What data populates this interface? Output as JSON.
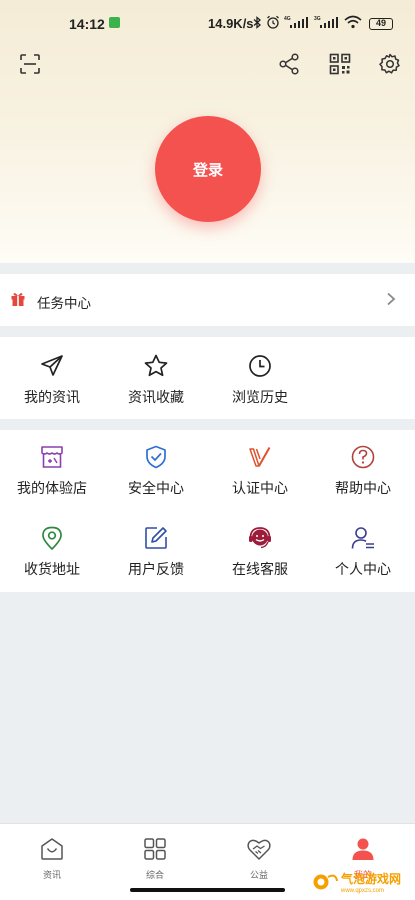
{
  "status_bar": {
    "time": "14:12",
    "net_speed": "14.9K/s",
    "signal1_label": "4G",
    "signal2_label": "3G",
    "battery": "49"
  },
  "header": {
    "scan_icon": "scan-icon",
    "share_icon": "share-icon",
    "qr_icon": "qrcode-icon",
    "settings_icon": "gear-icon",
    "login_label": "登录",
    "login_color": "#f4524f"
  },
  "task_center": {
    "label": "任务中心"
  },
  "quick_links": [
    {
      "label": "我的资讯",
      "icon": "send-icon"
    },
    {
      "label": "资讯收藏",
      "icon": "star-icon"
    },
    {
      "label": "浏览历史",
      "icon": "clock-icon"
    }
  ],
  "services": [
    {
      "label": "我的体验店",
      "icon": "store-icon",
      "color": "#8a3fb3"
    },
    {
      "label": "安全中心",
      "icon": "shield-icon",
      "color": "#2f6fd6"
    },
    {
      "label": "认证中心",
      "icon": "verify-icon",
      "color": "#e0522f"
    },
    {
      "label": "帮助中心",
      "icon": "help-icon",
      "color": "#b2413b"
    },
    {
      "label": "收货地址",
      "icon": "location-icon",
      "color": "#2d8a3e"
    },
    {
      "label": "用户反馈",
      "icon": "feedback-icon",
      "color": "#2f4fa6"
    },
    {
      "label": "在线客服",
      "icon": "headset-icon",
      "color": "#9c1d3b"
    },
    {
      "label": "个人中心",
      "icon": "person-icon",
      "color": "#3b3e8f"
    }
  ],
  "tabbar": [
    {
      "label": "资讯",
      "icon": "home-icon",
      "active": false
    },
    {
      "label": "综合",
      "icon": "grid-icon",
      "active": false
    },
    {
      "label": "公益",
      "icon": "charity-icon",
      "active": false
    },
    {
      "label": "我的",
      "icon": "person-icon",
      "active": true
    }
  ],
  "watermark": {
    "text": "气泡游戏网",
    "url": "www.qpxzs.com"
  }
}
